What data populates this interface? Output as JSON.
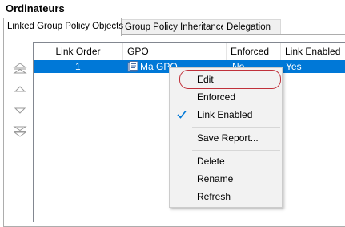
{
  "header": {
    "title": "Ordinateurs"
  },
  "tabs": [
    {
      "label": "Linked Group Policy Objects"
    },
    {
      "label": "Group Policy Inheritance"
    },
    {
      "label": "Delegation"
    }
  ],
  "side_buttons": [
    {
      "icon": "move-to-top-icon"
    },
    {
      "icon": "move-up-icon"
    },
    {
      "icon": "move-down-icon"
    },
    {
      "icon": "move-to-bottom-icon"
    }
  ],
  "table": {
    "columns": [
      "Link Order",
      "GPO",
      "Enforced",
      "Link Enabled"
    ],
    "sort_column": "Link Order",
    "rows": [
      {
        "link_order": "1",
        "gpo": "Ma GPO",
        "enforced": "No",
        "link_enabled": "Yes"
      }
    ]
  },
  "context_menu": {
    "items": [
      {
        "label": "Edit"
      },
      {
        "label": "Enforced"
      },
      {
        "label": "Link Enabled",
        "checked": true
      },
      {
        "label": "Save Report..."
      },
      {
        "label": "Delete"
      },
      {
        "label": "Rename"
      },
      {
        "label": "Refresh"
      }
    ]
  },
  "colors": {
    "selection": "#0078d7",
    "menu_background": "#f2f2f2",
    "check": "#0078d7",
    "annotation": "#c0303a"
  }
}
